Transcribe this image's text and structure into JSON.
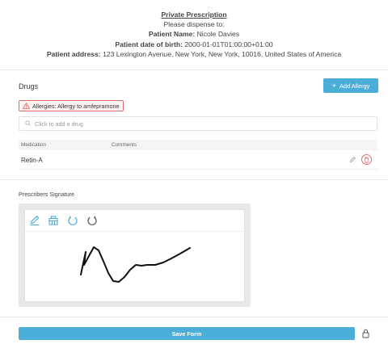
{
  "header": {
    "title": "Private Prescription",
    "dispense_line": "Please dispense to:",
    "patient_name_label": "Patient Name:",
    "patient_name": "Nicole Davies",
    "dob_label": "Patient date of birth:",
    "dob": "2000-01-01T01:00:00+01:00",
    "address_label": "Patient address:",
    "address": "123 Lexington Avenue, New York, New York, 10016, United States of America"
  },
  "drugs": {
    "section_label": "Drugs",
    "add_allergy_label": "Add Allergy",
    "allergy_badge": "Allergies: Allergy to amfepramone",
    "search_placeholder": "Click to add a drug",
    "columns": [
      "Medication",
      "Comments"
    ],
    "rows": [
      {
        "medication": "Retin-A",
        "comments": ""
      }
    ]
  },
  "signature": {
    "label": "Prescribers Signature",
    "tools": [
      "pen-icon",
      "eraser-icon",
      "undo-icon",
      "redo-icon"
    ]
  },
  "footer": {
    "save_label": "Save Form",
    "lock_icon": "lock-icon"
  },
  "colors": {
    "accent": "#4aaed8",
    "danger": "#e06b6b"
  }
}
